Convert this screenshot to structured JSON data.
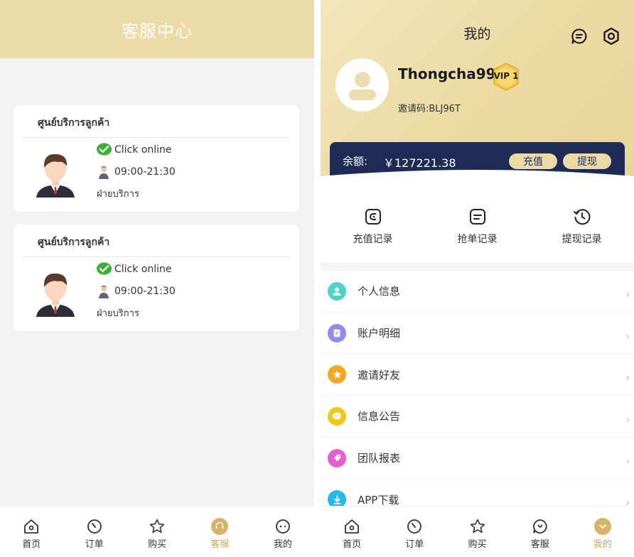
{
  "left": {
    "title": "客服中心",
    "cards": [
      {
        "title": "ศูนย์บริการลูกค้า",
        "online": "Click online",
        "hours": "09:00-21:30",
        "dept": "ฝ่ายบริการ"
      },
      {
        "title": "ศูนย์บริการลูกค้า",
        "online": "Click online",
        "hours": "09:00-21:30",
        "dept": "ฝ่ายบริการ"
      }
    ],
    "tabs": [
      {
        "label": "首页",
        "icon": "home-icon"
      },
      {
        "label": "订单",
        "icon": "order-icon"
      },
      {
        "label": "购买",
        "icon": "star-icon"
      },
      {
        "label": "客服",
        "icon": "service-icon",
        "active": true
      },
      {
        "label": "我的",
        "icon": "user-icon"
      }
    ]
  },
  "right": {
    "title": "我的",
    "username": "Thongcha99",
    "vip": "VIP 1",
    "invite_code": "邀请码:BLJ96T",
    "balance_label": "余额:",
    "balance_amount": "￥127221.38",
    "recharge": "充值",
    "withdraw": "提现",
    "shortcuts": [
      {
        "label": "充值记录",
        "icon": "wallet-icon"
      },
      {
        "label": "抢单记录",
        "icon": "list-icon"
      },
      {
        "label": "提现记录",
        "icon": "history-icon"
      }
    ],
    "menu": [
      {
        "label": "个人信息",
        "icon": "person-icon",
        "color": "#4fd3c4"
      },
      {
        "label": "账户明细",
        "icon": "document-icon",
        "color": "#8f8cf0"
      },
      {
        "label": "邀请好友",
        "icon": "star-badge-icon",
        "color": "#f5a623"
      },
      {
        "label": "信息公告",
        "icon": "chat-dots-icon",
        "color": "#f5c518"
      },
      {
        "label": "团队报表",
        "icon": "tag-icon",
        "color": "#e85ecf"
      },
      {
        "label": "APP下载",
        "icon": "download-icon",
        "color": "#22b8f0"
      }
    ],
    "tabs": [
      {
        "label": "首页",
        "icon": "home-icon"
      },
      {
        "label": "订单",
        "icon": "order-icon"
      },
      {
        "label": "购买",
        "icon": "star-icon"
      },
      {
        "label": "客服",
        "icon": "service-icon"
      },
      {
        "label": "我的",
        "icon": "user-icon",
        "active": true
      }
    ]
  },
  "colors": {
    "header_gold": "#ecdba6",
    "navy": "#1e2c55",
    "accent": "#c9a75e"
  }
}
